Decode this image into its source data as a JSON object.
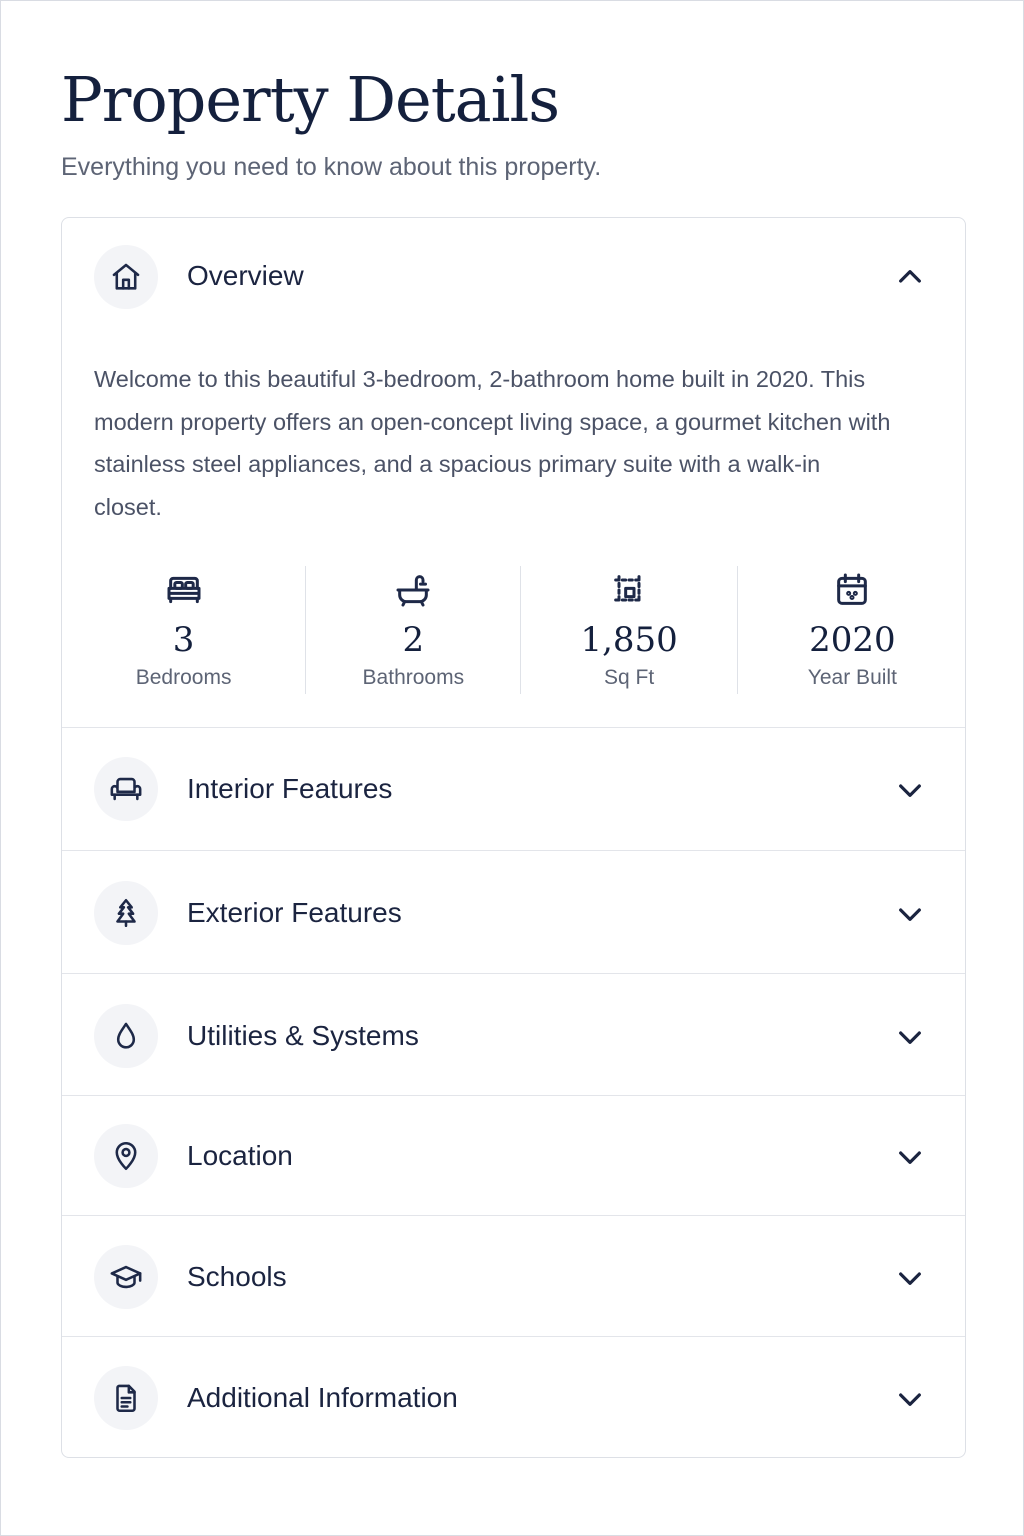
{
  "header": {
    "title": "Property Details",
    "subtitle": "Everything you need to know about this property."
  },
  "overview": {
    "label": "Overview",
    "icon": "home-icon",
    "expanded": true,
    "description": "Welcome to this beautiful 3-bedroom, 2-bathroom home built in 2020. This modern property offers an open-concept living space, a gourmet kitchen with stainless steel appliances, and a spacious primary suite with a walk-in closet.",
    "stats": [
      {
        "icon": "bed-icon",
        "value": "3",
        "label": "Bedrooms"
      },
      {
        "icon": "bathtub-icon",
        "value": "2",
        "label": "Bathrooms"
      },
      {
        "icon": "area-icon",
        "value": "1,850",
        "label": "Sq Ft"
      },
      {
        "icon": "calendar-icon",
        "value": "2020",
        "label": "Year Built"
      }
    ]
  },
  "sections": [
    {
      "label": "Interior Features",
      "icon": "armchair-icon",
      "expanded": false
    },
    {
      "label": "Exterior Features",
      "icon": "tree-icon",
      "expanded": false
    },
    {
      "label": "Utilities & Systems",
      "icon": "water-drop-icon",
      "expanded": false
    },
    {
      "label": "Location",
      "icon": "map-pin-icon",
      "expanded": false
    },
    {
      "label": "Schools",
      "icon": "graduation-cap-icon",
      "expanded": false
    },
    {
      "label": "Additional Information",
      "icon": "document-icon",
      "expanded": false
    }
  ],
  "colors": {
    "text": "#1b2440",
    "muted": "#5d6475",
    "border": "#dde0e6",
    "icon_bg": "#f3f4f7"
  }
}
